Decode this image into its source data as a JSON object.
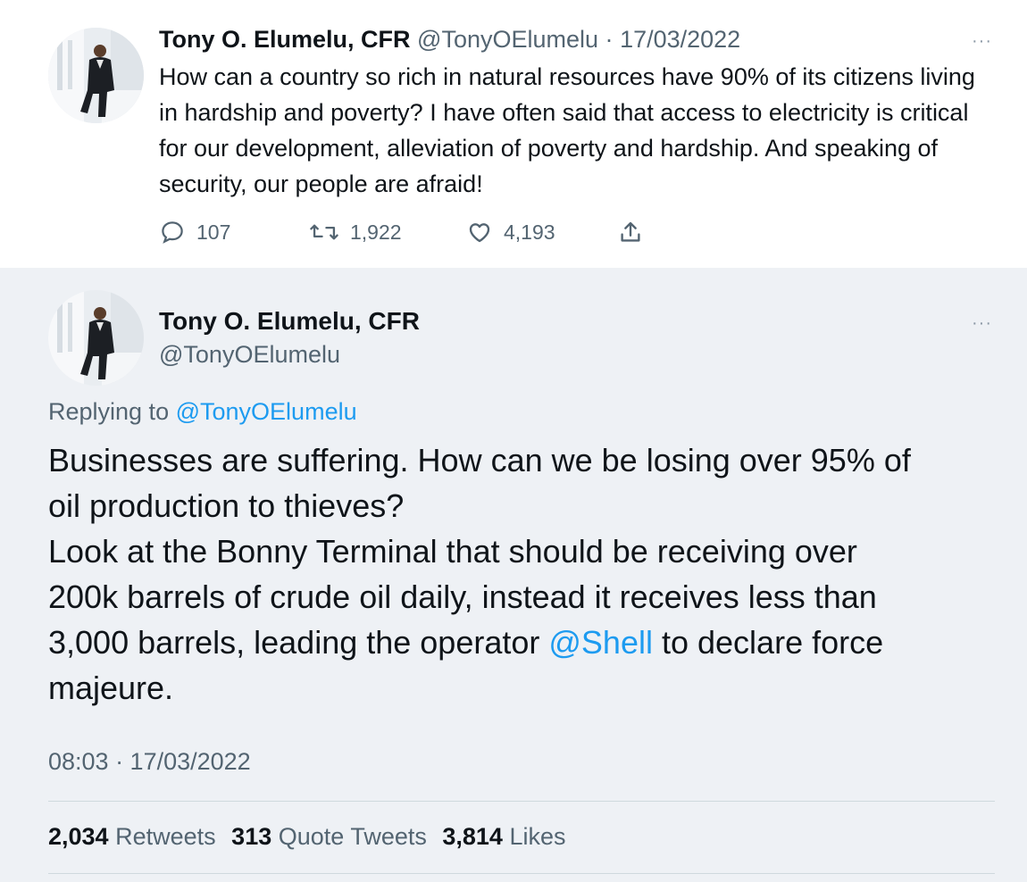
{
  "tweet1": {
    "name": "Tony O. Elumelu, CFR",
    "handle": "@TonyOElumelu",
    "separator": "·",
    "date": "17/03/2022",
    "more": "···",
    "text": "How can a country so rich in natural resources have 90% of its citizens living in hardship and poverty? I have often said that access to electricity is critical for our development, alleviation of poverty and hardship. And speaking of security, our people are afraid!",
    "actions": {
      "replies": "107",
      "retweets": "1,922",
      "likes": "4,193"
    },
    "icons": [
      "reply-icon",
      "retweet-icon",
      "like-icon",
      "share-icon"
    ]
  },
  "tweet2": {
    "name": "Tony O. Elumelu, CFR",
    "handle": "@TonyOElumelu",
    "more": "···",
    "replying_label": "Replying to",
    "replying_handle": "@TonyOElumelu",
    "text_lines": {
      "l1": "Businesses are suffering. How can we be losing over 95% of",
      "l2": "oil production to thieves?",
      "l3": "Look at the Bonny Terminal that should be receiving over",
      "l4": "200k barrels of crude oil daily, instead it receives less than",
      "l5_before": "3,000 barrels, leading the operator ",
      "l5_mention": "@Shell",
      "l5_after": " to declare force",
      "l6": "majeure."
    },
    "timestamp": "08:03 · 17/03/2022",
    "stats": {
      "retweets_count": "2,034",
      "retweets_label": "Retweets",
      "quotes_count": "313",
      "quotes_label": "Quote Tweets",
      "likes_count": "3,814",
      "likes_label": "Likes"
    }
  },
  "colors": {
    "text": "#0f1419",
    "muted": "#536471",
    "link": "#1d9bf0",
    "main_tweet_bg": "#eef1f5",
    "divider": "#cfd9de"
  }
}
